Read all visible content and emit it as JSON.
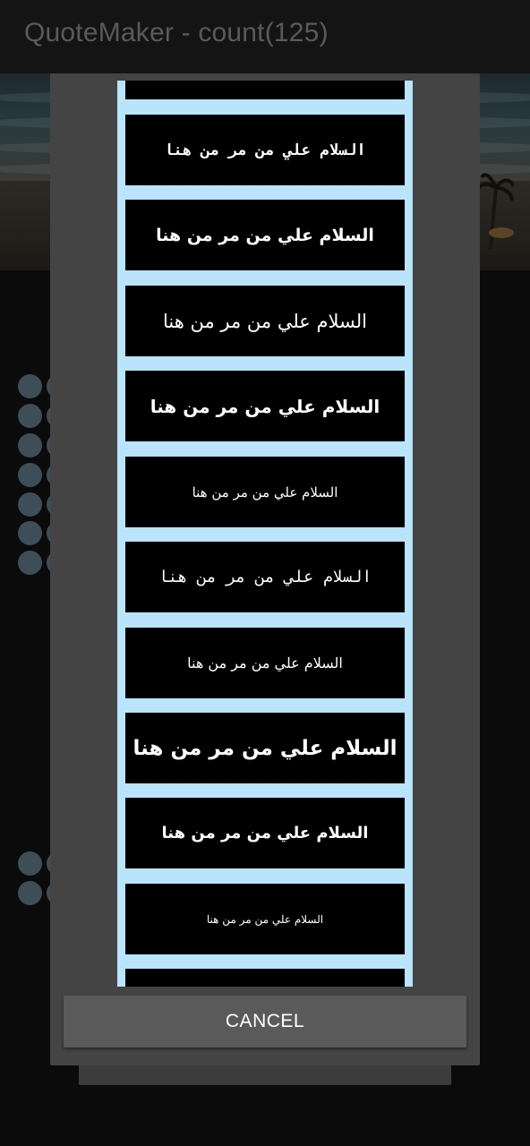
{
  "app": {
    "title": "QuoteMaker - count(125)"
  },
  "dialog": {
    "font_items": [
      {
        "text": ""
      },
      {
        "text": "السلام علي من مر من هنا"
      },
      {
        "text": "السلام علي من مر من هنا"
      },
      {
        "text": "السلام علي من مر من هنا"
      },
      {
        "text": "السلام علي من مر من هنا"
      },
      {
        "text": "السلام علي من مر من هنا"
      },
      {
        "text": "السلام علي من مر من هنا"
      },
      {
        "text": "السلام علي من مر من هنا"
      },
      {
        "text": "السلام علي من مر من هنا"
      },
      {
        "text": "السلام علي من مر من هنا"
      },
      {
        "text": "السلام علي من مر من هنا"
      },
      {
        "text": ""
      }
    ],
    "cancel_label": "CANCEL"
  },
  "colors": {
    "list_background": "#b9e4fb",
    "item_background": "#000000",
    "item_text": "#ffffff",
    "dialog_background": "#444444",
    "button_background": "#5a5a5a",
    "dim_dot": "#3d4e58"
  }
}
